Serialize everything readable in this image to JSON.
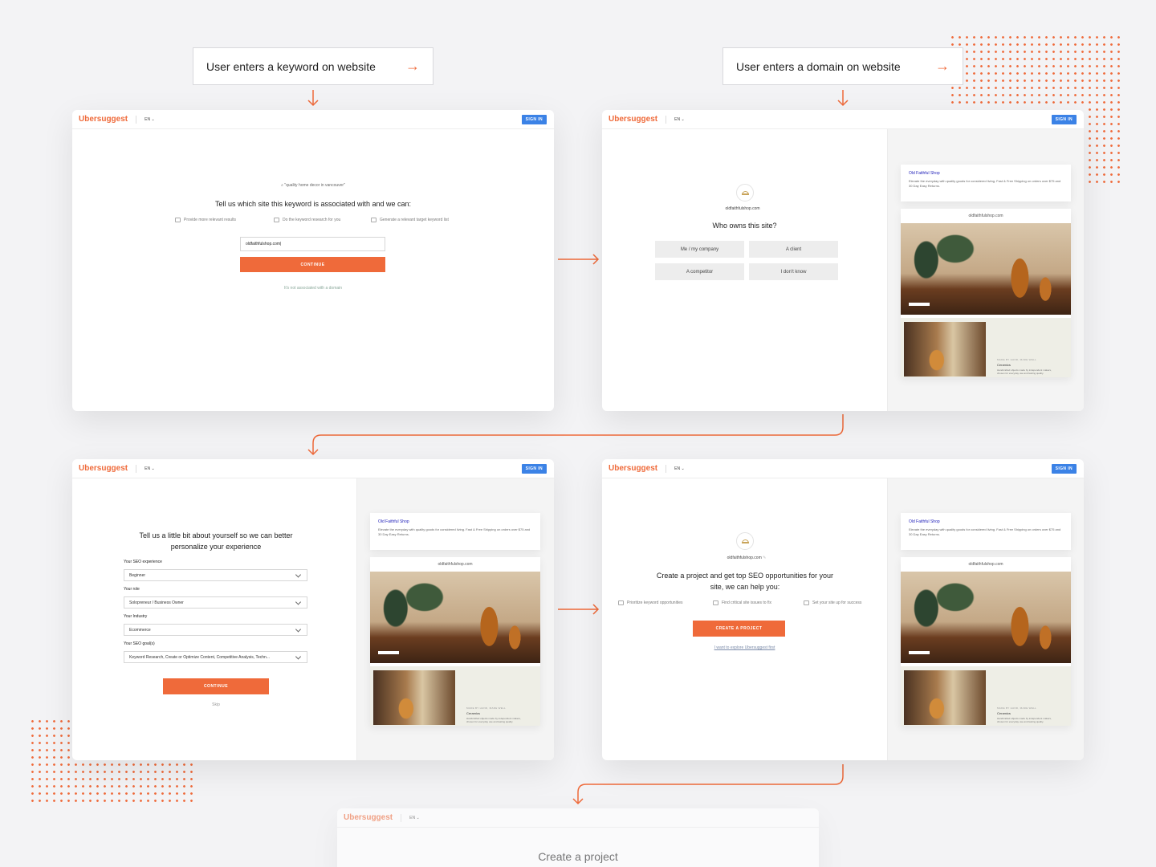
{
  "flow": {
    "keyword_label": "User enters a keyword on website",
    "domain_label": "User enters a domain on website"
  },
  "brand": {
    "name": "Ubersuggest",
    "accent": "#ef6a3a",
    "signin_color": "#3b82e6"
  },
  "topbar": {
    "lang": "EN",
    "signin": "SIGN IN"
  },
  "screen1": {
    "search_query": "\"quality home decor in vancouver\"",
    "heading": "Tell us which site this keyword is associated with and we can:",
    "features": [
      "Provide more relevant results",
      "Do the keyword research for you",
      "Generate a relevant target keyword list"
    ],
    "domain_value": "oldfaithfulshop.com|",
    "continue": "CONTINUE",
    "not_associated": "It's not associated with a domain"
  },
  "screen2": {
    "domain": "oldfaithfulshop.com",
    "question": "Who owns this site?",
    "options": [
      "Me / my company",
      "A client",
      "A competitor",
      "I don't know"
    ]
  },
  "shop_preview": {
    "title": "Old Faithful Shop",
    "description": "Elevate the everyday with quality goods for considered living. Fast & Free Shipping on orders over $75 and 30 Day Easy Returns.",
    "url": "oldfaithfulshop.com",
    "caption_kicker": "MADE BY HAND, MADE WELL",
    "caption_title": "Ceramics",
    "caption_body": "Handcrafted objects made by independent makers, chosen for everyday use and lasting quality."
  },
  "screen3": {
    "heading": "Tell us a little bit about yourself so we can better personalize your experience",
    "fields": [
      {
        "label": "Your SEO experience",
        "value": "Beginner"
      },
      {
        "label": "Your role",
        "value": "Solopreneur / Business Owner"
      },
      {
        "label": "Your Industry",
        "value": "Ecommerce"
      },
      {
        "label": "Your SEO goal(s)",
        "value": "Keyword Research, Create or Optimize Content, Competitive Analysis, Techn..."
      }
    ],
    "continue": "CONTINUE",
    "skip": "Skip"
  },
  "screen4": {
    "domain": "oldfaithfulshop.com",
    "heading": "Create a project and get top SEO opportunities for your site, we can help you:",
    "features": [
      "Prioritize keyword opportunities",
      "Find critical site issues to fix",
      "Set your site up for success"
    ],
    "create": "CREATE A PROJECT",
    "explore": "I want to explore Ubersuggest first"
  },
  "screen5": {
    "heading": "Create a project"
  }
}
